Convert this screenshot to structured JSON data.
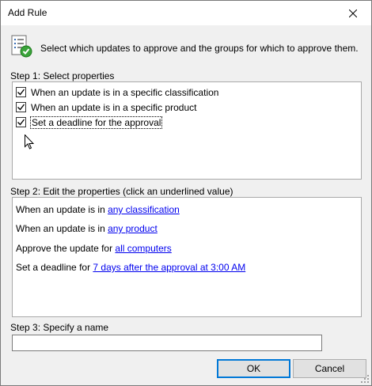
{
  "window": {
    "title": "Add Rule"
  },
  "header": {
    "text": "Select which updates to approve and the groups for which to approve them."
  },
  "step1": {
    "label": "Step 1: Select properties",
    "items": [
      {
        "label": "When an update is in a specific classification",
        "checked": true
      },
      {
        "label": "When an update is in a specific product",
        "checked": true
      },
      {
        "label": "Set a deadline for the approval",
        "checked": true
      }
    ]
  },
  "step2": {
    "label": "Step 2: Edit the properties (click an underlined value)",
    "lines": [
      {
        "prefix": "When an update is in ",
        "link": "any classification"
      },
      {
        "prefix": "When an update is in ",
        "link": "any product"
      },
      {
        "prefix": "Approve the update for ",
        "link": "all computers"
      },
      {
        "prefix": "Set a deadline for ",
        "link": "7 days after the approval at 3:00 AM"
      }
    ]
  },
  "step3": {
    "label": "Step 3: Specify a name",
    "value": ""
  },
  "buttons": {
    "ok": "OK",
    "cancel": "Cancel"
  },
  "colors": {
    "link": "#0000ee",
    "accent": "#0078d7"
  }
}
